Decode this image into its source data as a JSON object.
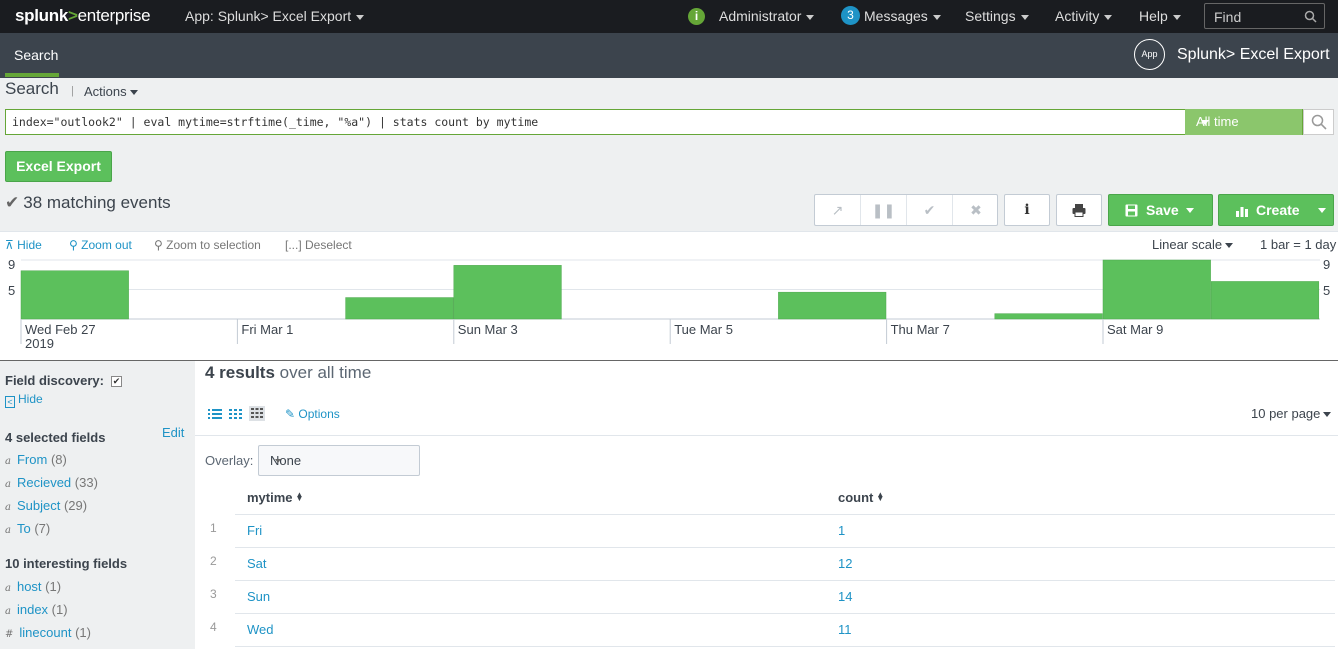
{
  "topbar": {
    "logo_brand": "splunk",
    "logo_gt": ">",
    "logo_product": "enterprise",
    "app_menu": "App: Splunk> Excel Export",
    "admin": "Administrator",
    "messages_count": "3",
    "messages": "Messages",
    "settings": "Settings",
    "activity": "Activity",
    "help": "Help",
    "find_placeholder": "Find",
    "info_glyph": "i"
  },
  "appbar": {
    "tab_search": "Search",
    "app_badge": "App",
    "app_name": "Splunk> Excel Export"
  },
  "search": {
    "title": "Search",
    "actions": "Actions",
    "query": "index=\"outlook2\" | eval mytime=strftime(_time, \"%a\") | stats count by mytime",
    "time_range": "All time",
    "excel_export": "Excel Export",
    "matching_events": "38 matching events",
    "save": "Save",
    "create": "Create"
  },
  "timeline": {
    "hide": "Hide",
    "zoom_out": "Zoom out",
    "zoom_selection": "Zoom to selection",
    "deselect": "Deselect",
    "scale": "Linear scale",
    "bar_span": "1 bar = 1 day",
    "y_ticks": [
      "9",
      "5"
    ],
    "x_labels": [
      "Wed Feb 27",
      "Fri Mar 1",
      "Sun Mar 3",
      "Tue Mar 5",
      "Thu Mar 7",
      "Sat Mar 9"
    ],
    "year_label": "2019",
    "counts": [
      9,
      0,
      0,
      4,
      10,
      0,
      0,
      5,
      0,
      1,
      11,
      7
    ],
    "max_count": 11,
    "bar_color": "#5cc05c"
  },
  "sidebar": {
    "field_discovery": "Field discovery:",
    "hide": "Hide",
    "selected_header": "4 selected fields",
    "edit": "Edit",
    "selected_fields": [
      {
        "type": "a",
        "name": "From",
        "count": "(8)"
      },
      {
        "type": "a",
        "name": "Recieved",
        "count": "(33)"
      },
      {
        "type": "a",
        "name": "Subject",
        "count": "(29)"
      },
      {
        "type": "a",
        "name": "To",
        "count": "(7)"
      }
    ],
    "interesting_header": "10 interesting fields",
    "interesting_fields": [
      {
        "type": "a",
        "name": "host",
        "count": "(1)"
      },
      {
        "type": "a",
        "name": "index",
        "count": "(1)"
      },
      {
        "type": "#",
        "name": "linecount",
        "count": "(1)"
      }
    ]
  },
  "results": {
    "count_bold": "4 results",
    "count_rest": " over all time",
    "options": "Options",
    "per_page": "10 per page",
    "overlay_label": "Overlay:",
    "overlay_value": "None",
    "columns": [
      "mytime",
      "count"
    ],
    "rows": [
      {
        "num": "1",
        "mytime": "Fri",
        "count": "1"
      },
      {
        "num": "2",
        "mytime": "Sat",
        "count": "12"
      },
      {
        "num": "3",
        "mytime": "Sun",
        "count": "14"
      },
      {
        "num": "4",
        "mytime": "Wed",
        "count": "11"
      }
    ]
  },
  "colors": {
    "accent_green": "#65a637",
    "link_blue": "#1e93c6",
    "topbar_bg": "#1a1c20",
    "appbar_bg": "#3c444d"
  }
}
